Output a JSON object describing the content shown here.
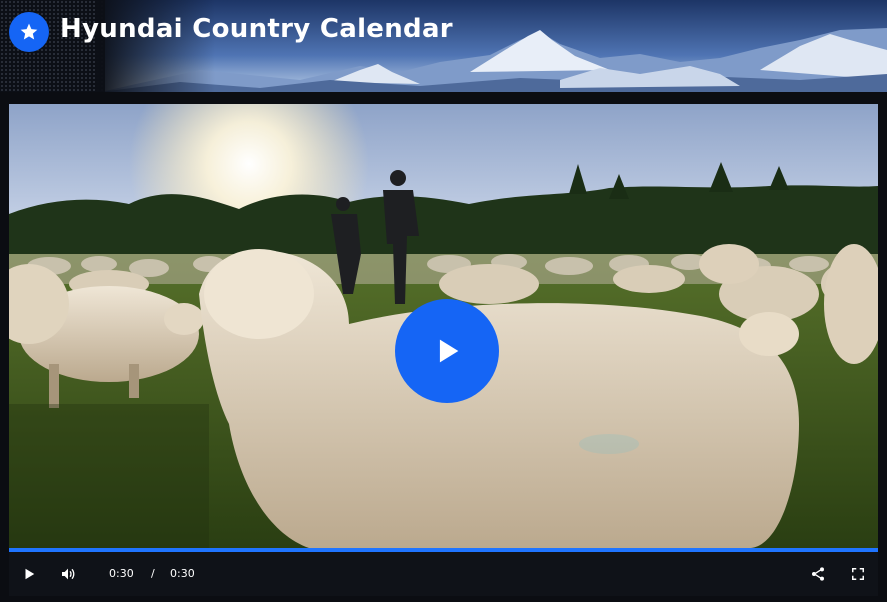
{
  "header": {
    "title": "Hyundai Country Calendar",
    "brand_color": "#1565f5",
    "logo_icon": "star-icon"
  },
  "player": {
    "current_time": "0:30",
    "separator": "/",
    "duration": "0:30",
    "progress_fraction": 1.0,
    "progress_color": "#1f74ff",
    "play_button_color": "#1565f5",
    "icons": {
      "big_play": "play-icon",
      "play": "play-icon",
      "volume": "volume-icon",
      "share": "share-icon",
      "fullscreen": "fullscreen-icon"
    }
  }
}
